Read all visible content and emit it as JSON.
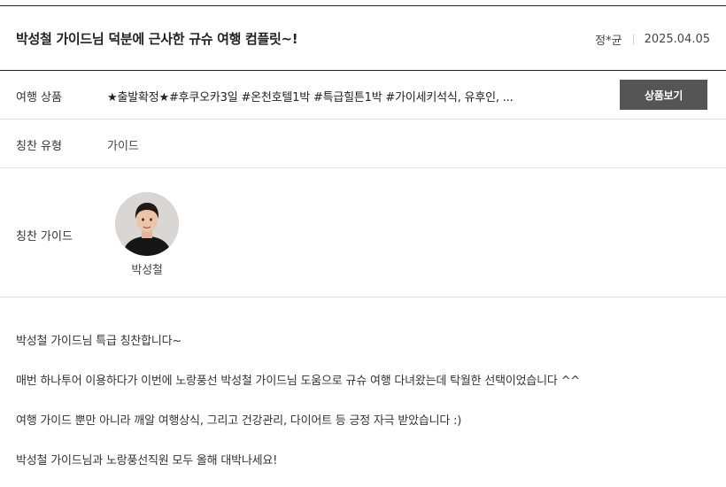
{
  "header": {
    "title": "박성철 가이드님 덕분에 근사한 규슈 여행 컴플릿~!",
    "author": "정*균",
    "date": "2025.04.05"
  },
  "product": {
    "label": "여행 상품",
    "value": "★출발확정★#후쿠오카3일 #온천호텔1박 #특급힐튼1박 #가이세키석식, 유후인, ...",
    "button_label": "상품보기"
  },
  "praise_type": {
    "label": "칭찬 유형",
    "value": "가이드"
  },
  "praise_guide": {
    "label": "칭찬 가이드",
    "name": "박성철"
  },
  "content": {
    "paragraphs": [
      "박성철 가이드님 특급 칭찬합니다~",
      "매번 하나투어 이용하다가 이번에 노랑풍선 박성철 가이드님 도움으로 규슈 여행 다녀왔는데 탁월한 선택이었습니다 ^^",
      "여행 가이드 뿐만 아니라 깨알 여행상식, 그리고 건강관리, 다이어트 등 긍정 자극 받았습니다 :)",
      "박성철 가이드님과 노랑풍선직원 모두 올해 대박나세요!"
    ]
  }
}
